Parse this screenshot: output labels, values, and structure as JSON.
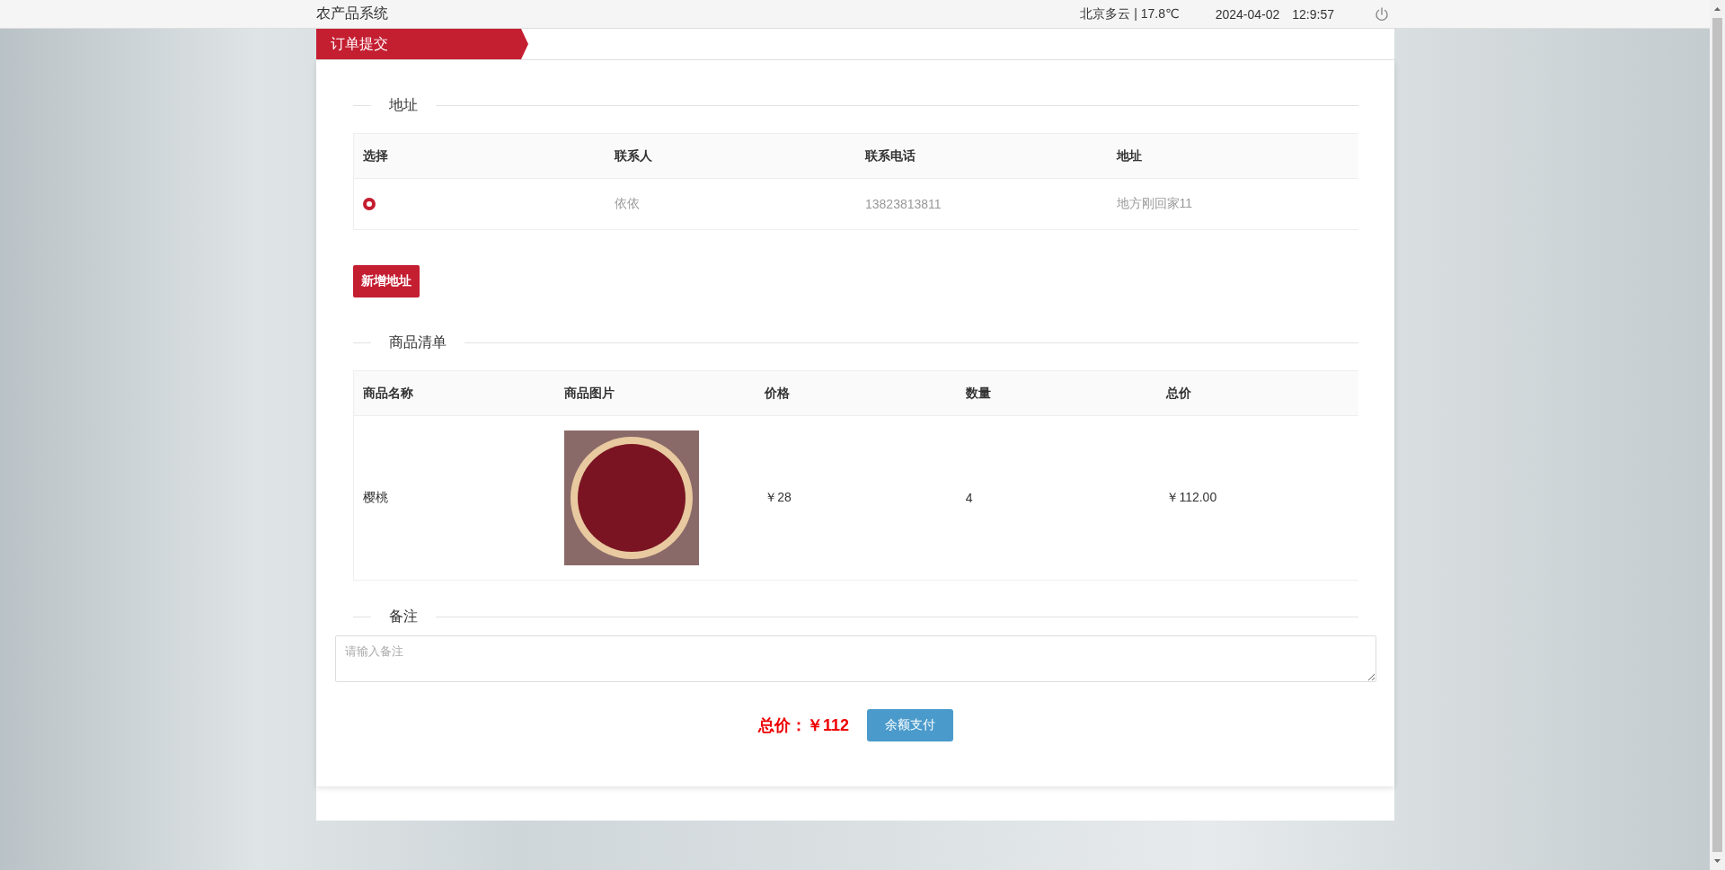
{
  "header": {
    "title": "农产品系统",
    "weather": "北京多云 | 17.8℃",
    "date": "2024-04-02",
    "time": "12:9:57"
  },
  "tab": {
    "label": "订单提交"
  },
  "address_section": {
    "heading": "地址",
    "columns": [
      "选择",
      "联系人",
      "联系电话",
      "地址"
    ],
    "rows": [
      {
        "selected": true,
        "contact": "依依",
        "phone": "13823813811",
        "address": "地方刚回家11"
      }
    ],
    "add_button": "新增地址"
  },
  "goods_section": {
    "heading": "商品清单",
    "columns": [
      "商品名称",
      "商品图片",
      "价格",
      "数量",
      "总价"
    ],
    "rows": [
      {
        "name": "樱桃",
        "price": "￥28",
        "quantity": "4",
        "total": "￥112.00"
      }
    ]
  },
  "remark_section": {
    "heading": "备注",
    "placeholder": "请输入备注"
  },
  "footer": {
    "total": "总价：￥112",
    "pay_button": "余额支付"
  }
}
